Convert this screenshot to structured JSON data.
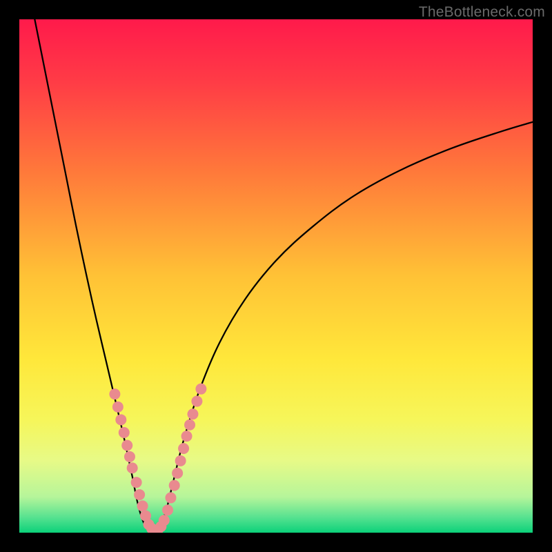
{
  "watermark": "TheBottleneck.com",
  "chart_data": {
    "type": "line",
    "title": "",
    "xlabel": "",
    "ylabel": "",
    "xlim": [
      0,
      100
    ],
    "ylim": [
      0,
      100
    ],
    "gradient_stops": [
      {
        "offset": 0,
        "color": "#ff1a4b"
      },
      {
        "offset": 0.12,
        "color": "#ff3b46"
      },
      {
        "offset": 0.3,
        "color": "#ff7a3a"
      },
      {
        "offset": 0.5,
        "color": "#ffc236"
      },
      {
        "offset": 0.66,
        "color": "#ffe73a"
      },
      {
        "offset": 0.78,
        "color": "#f6f65a"
      },
      {
        "offset": 0.86,
        "color": "#e7fa87"
      },
      {
        "offset": 0.93,
        "color": "#b6f59a"
      },
      {
        "offset": 0.97,
        "color": "#57e290"
      },
      {
        "offset": 1.0,
        "color": "#0bd17a"
      }
    ],
    "series": [
      {
        "name": "left-curve",
        "x": [
          3.0,
          5.0,
          7.0,
          9.0,
          11.0,
          13.0,
          15.0,
          17.0,
          19.0,
          20.5,
          22.0,
          23.0,
          24.0,
          25.0
        ],
        "y": [
          100,
          90.0,
          80.0,
          70.0,
          60.0,
          50.5,
          41.5,
          33.0,
          24.5,
          18.0,
          11.0,
          6.0,
          2.5,
          0.5
        ]
      },
      {
        "name": "right-curve",
        "x": [
          27.0,
          28.5,
          30.0,
          32.0,
          35.0,
          39.0,
          44.0,
          50.0,
          57.0,
          65.0,
          74.0,
          84.0,
          94.0,
          100.0
        ],
        "y": [
          0.5,
          4.0,
          10.0,
          18.0,
          27.5,
          37.0,
          45.5,
          53.0,
          59.5,
          65.5,
          70.5,
          74.8,
          78.2,
          80.0
        ]
      }
    ],
    "dot_clusters": [
      {
        "name": "left-branch-dots",
        "cluster_type": "elongated",
        "points": [
          {
            "x": 18.6,
            "y": 27.0
          },
          {
            "x": 19.2,
            "y": 24.5
          },
          {
            "x": 19.8,
            "y": 22.0
          },
          {
            "x": 20.4,
            "y": 19.5
          },
          {
            "x": 21.0,
            "y": 17.0
          },
          {
            "x": 21.5,
            "y": 14.8
          },
          {
            "x": 22.0,
            "y": 12.6
          }
        ]
      },
      {
        "name": "left-lower-dots",
        "cluster_type": "loose",
        "points": [
          {
            "x": 22.8,
            "y": 9.8
          },
          {
            "x": 23.4,
            "y": 7.4
          },
          {
            "x": 24.0,
            "y": 5.2
          },
          {
            "x": 24.6,
            "y": 3.3
          }
        ]
      },
      {
        "name": "valley-dots",
        "cluster_type": "elongated",
        "points": [
          {
            "x": 25.2,
            "y": 1.6
          },
          {
            "x": 25.8,
            "y": 0.8
          },
          {
            "x": 26.4,
            "y": 0.5
          },
          {
            "x": 27.0,
            "y": 0.6
          },
          {
            "x": 27.6,
            "y": 1.2
          },
          {
            "x": 28.2,
            "y": 2.4
          }
        ]
      },
      {
        "name": "right-lower-dots",
        "cluster_type": "loose",
        "points": [
          {
            "x": 28.9,
            "y": 4.4
          },
          {
            "x": 29.5,
            "y": 6.8
          },
          {
            "x": 30.2,
            "y": 9.2
          }
        ]
      },
      {
        "name": "right-branch-dots",
        "cluster_type": "elongated",
        "points": [
          {
            "x": 30.8,
            "y": 11.6
          },
          {
            "x": 31.4,
            "y": 14.0
          },
          {
            "x": 32.0,
            "y": 16.4
          },
          {
            "x": 32.6,
            "y": 18.8
          },
          {
            "x": 33.2,
            "y": 21.0
          },
          {
            "x": 33.8,
            "y": 23.1
          }
        ]
      },
      {
        "name": "right-upper-dots",
        "cluster_type": "loose",
        "points": [
          {
            "x": 34.6,
            "y": 25.6
          },
          {
            "x": 35.4,
            "y": 28.0
          }
        ]
      }
    ],
    "dot_style": {
      "fill": "#e98a8f",
      "radius_px": 8
    }
  }
}
